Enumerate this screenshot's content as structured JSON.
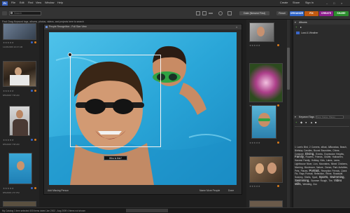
{
  "menubar": {
    "items": [
      "File",
      "Edit",
      "Find",
      "View",
      "Window",
      "Help"
    ],
    "right": [
      "Create",
      "Share",
      "Sign In"
    ]
  },
  "toolbar": {
    "search_placeholder": "Search",
    "sort_label": "Sort by",
    "sort_value": "Date (Newest First)",
    "reset_label": "Reset",
    "modes": [
      {
        "label": "ORGANIZE",
        "color": "#2f65c9"
      },
      {
        "label": "FIX",
        "color": "#c25a10"
      },
      {
        "label": "CREATE",
        "color": "#8e1f8e"
      },
      {
        "label": "SHARE",
        "color": "#2c8f2e"
      }
    ]
  },
  "hint": "Find: Drag Keyword tags, albums, photos, videos, and projects here to search",
  "grid_left": [
    {
      "date": "11/26/2009 10:47 AM",
      "stars": "★★★★★"
    },
    {
      "date": "8/5/2008 7:58 AM",
      "stars": "★★★★★"
    },
    {
      "date": "8/5/2008 7:58 AM",
      "stars": "★★★★★"
    },
    {
      "date": "8/5/2008 1:57 PM",
      "stars": "★★★★★"
    }
  ],
  "dialog": {
    "title": "People Recognition - Full Size View",
    "face_label": "Who is this?",
    "add_missing": "Add Missing Person",
    "name_more": "Name More People",
    "done": "Done"
  },
  "albums": {
    "header": "Albums",
    "item": "Land & Weather"
  },
  "keyword_tags": {
    "header": "Keyword Tags",
    "search_placeholder": "Tags, Faces, Places"
  },
  "tags": [
    "1 Lam's Bird,",
    "2 Corners,",
    "afloat,",
    "AlBuradaa,",
    "Beach,",
    "Birthday Candles,",
    "Bound Boundries,",
    "Chime,",
    "Costume,",
    "Diving,",
    "Events,",
    "Expressive Heights,",
    "Family,",
    "Flowers,",
    "Friends,",
    "Giraffe,",
    "Halloween,",
    "Harvest Family,",
    "Holiday,",
    "Kids,",
    "Lakes,",
    "Lama,",
    "Lighthouse Nicer,",
    "Lion,",
    "Mountains,",
    "Mixed Chickens,",
    "Morning,",
    "Mushroom,",
    "Nature,",
    "Ocean,",
    "Park Activities,",
    "Pets,",
    "Places,",
    "Portrait,",
    "Reception Friends,",
    "Quick Fix,",
    "Rays Portrait,",
    "Reflection,",
    "Rhine,",
    "Roadside,",
    "Scenery,",
    "Shells,",
    "Sport,",
    "Sports,",
    "Swimming,",
    "Swimming,",
    "Summer Rough,",
    "The,",
    "Video stills,",
    "Wedding,",
    "Zoo"
  ],
  "status": "My Catalog  1 item selected  400 items dated Jan 2002 - Aug 2009  4 items not shown",
  "icons": {
    "search": "search-icon",
    "gear": "gear-icon",
    "add": "plus-icon",
    "star": "star-icon"
  }
}
